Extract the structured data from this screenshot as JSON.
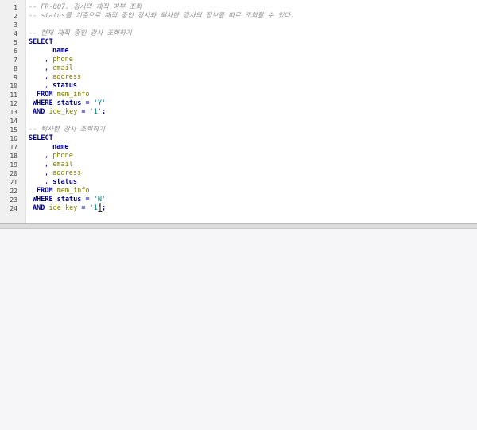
{
  "editor": {
    "lines": [
      {
        "n": "1",
        "indent": 0,
        "parts": [
          {
            "t": "-- FR-007. 강사의 재직 여부 조회",
            "c": "comment"
          }
        ]
      },
      {
        "n": "2",
        "indent": 0,
        "parts": [
          {
            "t": "-- status를 기준으로 재직 중인 강사와 퇴사한 강사의 정보를 따로 조회할 수 있다.",
            "c": "comment"
          }
        ]
      },
      {
        "n": "3",
        "indent": 0,
        "parts": []
      },
      {
        "n": "4",
        "indent": 0,
        "parts": [
          {
            "t": "-- 현재 재직 중인 강사 조회하기",
            "c": "comment"
          }
        ]
      },
      {
        "n": "5",
        "indent": 0,
        "parts": [
          {
            "t": "SELECT",
            "c": "kw"
          }
        ]
      },
      {
        "n": "6",
        "indent": 30,
        "parts": [
          {
            "t": "name",
            "c": "kw"
          }
        ]
      },
      {
        "n": "7",
        "indent": 20,
        "parts": [
          {
            "t": ", ",
            "c": "plain"
          },
          {
            "t": "phone",
            "c": "ident"
          }
        ]
      },
      {
        "n": "8",
        "indent": 20,
        "parts": [
          {
            "t": ", ",
            "c": "plain"
          },
          {
            "t": "email",
            "c": "ident"
          }
        ]
      },
      {
        "n": "9",
        "indent": 20,
        "parts": [
          {
            "t": ", ",
            "c": "plain"
          },
          {
            "t": "address",
            "c": "ident"
          }
        ]
      },
      {
        "n": "10",
        "indent": 20,
        "parts": [
          {
            "t": ", ",
            "c": "plain"
          },
          {
            "t": "status",
            "c": "kw"
          }
        ]
      },
      {
        "n": "11",
        "indent": 10,
        "parts": [
          {
            "t": "FROM ",
            "c": "kw"
          },
          {
            "t": "mem_info",
            "c": "ident"
          }
        ]
      },
      {
        "n": "12",
        "indent": 5,
        "parts": [
          {
            "t": "WHERE status = ",
            "c": "kw"
          },
          {
            "t": "'Y'",
            "c": "str"
          }
        ]
      },
      {
        "n": "13",
        "indent": 5,
        "parts": [
          {
            "t": "AND ",
            "c": "kw"
          },
          {
            "t": "ide_key",
            "c": "ident"
          },
          {
            "t": " = ",
            "c": "kw"
          },
          {
            "t": "'1'",
            "c": "str"
          },
          {
            "t": ";",
            "c": "kw"
          }
        ]
      },
      {
        "n": "14",
        "indent": 0,
        "parts": []
      },
      {
        "n": "15",
        "indent": 0,
        "parts": [
          {
            "t": "-- 퇴사한 강사 조회하기",
            "c": "comment"
          }
        ]
      },
      {
        "n": "16",
        "indent": 0,
        "parts": [
          {
            "t": "SELECT",
            "c": "kw"
          }
        ]
      },
      {
        "n": "17",
        "indent": 30,
        "parts": [
          {
            "t": "name",
            "c": "kw"
          }
        ]
      },
      {
        "n": "18",
        "indent": 20,
        "parts": [
          {
            "t": ", ",
            "c": "plain"
          },
          {
            "t": "phone",
            "c": "ident"
          }
        ]
      },
      {
        "n": "19",
        "indent": 20,
        "parts": [
          {
            "t": ", ",
            "c": "plain"
          },
          {
            "t": "email",
            "c": "ident"
          }
        ]
      },
      {
        "n": "20",
        "indent": 20,
        "parts": [
          {
            "t": ", ",
            "c": "plain"
          },
          {
            "t": "address",
            "c": "ident"
          }
        ]
      },
      {
        "n": "21",
        "indent": 20,
        "parts": [
          {
            "t": ", ",
            "c": "plain"
          },
          {
            "t": "status",
            "c": "kw"
          }
        ]
      },
      {
        "n": "22",
        "indent": 10,
        "parts": [
          {
            "t": "FROM ",
            "c": "kw"
          },
          {
            "t": "mem_info",
            "c": "ident"
          }
        ]
      },
      {
        "n": "23",
        "indent": 5,
        "parts": [
          {
            "t": "WHERE status = ",
            "c": "kw"
          },
          {
            "t": "'N'",
            "c": "str"
          }
        ]
      },
      {
        "n": "24",
        "indent": 5,
        "parts": [
          {
            "t": "AND ",
            "c": "kw"
          },
          {
            "t": "ide_key",
            "c": "ident"
          },
          {
            "t": " = ",
            "c": "kw"
          },
          {
            "t": "'1'",
            "c": "str"
          },
          {
            "t": ";",
            "c": "kw"
          }
        ]
      }
    ]
  },
  "colors": {
    "keyword": "#00008b",
    "comment": "#8c8c8c",
    "string": "#008080",
    "identifier": "#7a7a00",
    "gutter_bg": "#f0f0f0",
    "result_bg": "#f6f6f8"
  },
  "icons": {
    "cursor": "text-cursor-icon"
  }
}
